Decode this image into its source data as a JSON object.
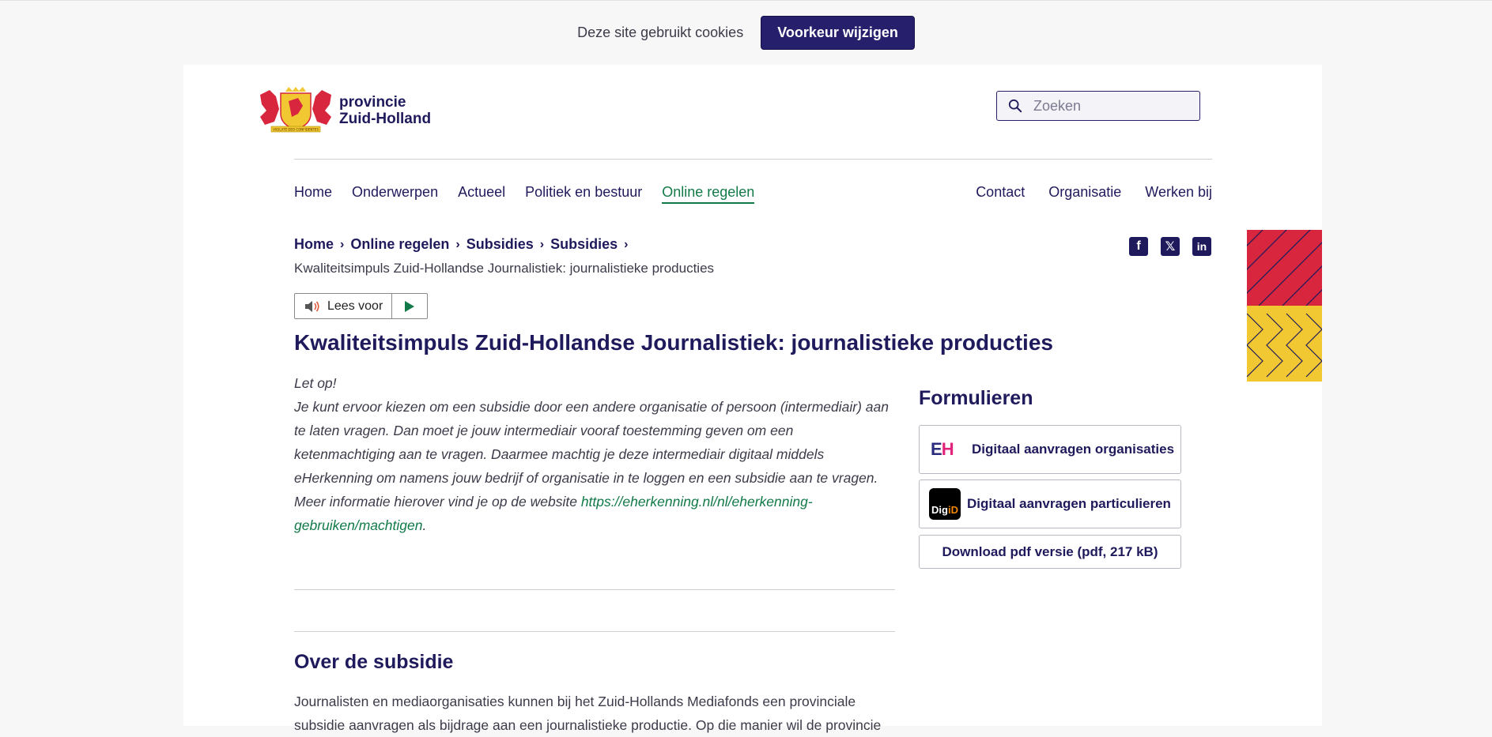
{
  "cookie": {
    "text": "Deze site gebruikt cookies",
    "button": "Voorkeur wijzigen"
  },
  "logo": {
    "line1": "provincie",
    "line2": "Zuid-Holland",
    "motto": "VIGILATE DEO CONFIDENTES"
  },
  "search": {
    "placeholder": "Zoeken"
  },
  "nav": {
    "main": [
      {
        "label": "Home"
      },
      {
        "label": "Onderwerpen"
      },
      {
        "label": "Actueel"
      },
      {
        "label": "Politiek en bestuur"
      },
      {
        "label": "Online regelen",
        "active": true
      }
    ],
    "secondary": [
      {
        "label": "Contact"
      },
      {
        "label": "Organisatie"
      },
      {
        "label": "Werken bij"
      }
    ]
  },
  "breadcrumb": {
    "items": [
      "Home",
      "Online regelen",
      "Subsidies",
      "Subsidies"
    ],
    "current": "Kwaliteitsimpuls Zuid-Hollandse Journalistiek: journalistieke producties"
  },
  "social": {
    "facebook": "f",
    "x": "𝕏",
    "linkedin": "in"
  },
  "readspeaker": {
    "label": "Lees voor"
  },
  "page": {
    "title": "Kwaliteitsimpuls Zuid-Hollandse Journalistiek: journalistieke producties"
  },
  "intro": {
    "heading": "Let op!",
    "text": "Je kunt ervoor kiezen om een subsidie door een andere organisatie of persoon (intermediair) aan te laten vragen. Dan moet  je jouw intermediair vooraf toestemming geven om een ketenmachtiging aan te vragen. Daarmee machtig je deze intermediair digitaal middels eHerkenning om namens jouw bedrijf of organisatie in te loggen en een subsidie aan te vragen. Meer informatie hierover vind je op de website ",
    "link": "https://eherkenning.nl/nl/eherkenning-gebruiken/machtigen",
    "end": "."
  },
  "section": {
    "title": "Over de subsidie",
    "text": "Journalisten en mediaorganisaties kunnen bij het Zuid-Hollands Mediafonds een provinciale subsidie aanvragen als bijdrage aan een journalistieke productie. Op die manier wil de provincie"
  },
  "forms": {
    "title": "Formulieren",
    "eh_button": "Digitaal aanvragen organisaties",
    "eh_logo_e": "E",
    "eh_logo_h": "H",
    "digid_button": "Digitaal aanvragen particulieren",
    "digid_logo_d": "Dig",
    "digid_logo_id": "iD",
    "pdf_button": "Download pdf versie (pdf, 217 kB)"
  },
  "colors": {
    "brand": "#261f6b",
    "active": "#117a48",
    "red": "#d7263d",
    "yellow": "#f2c832"
  }
}
